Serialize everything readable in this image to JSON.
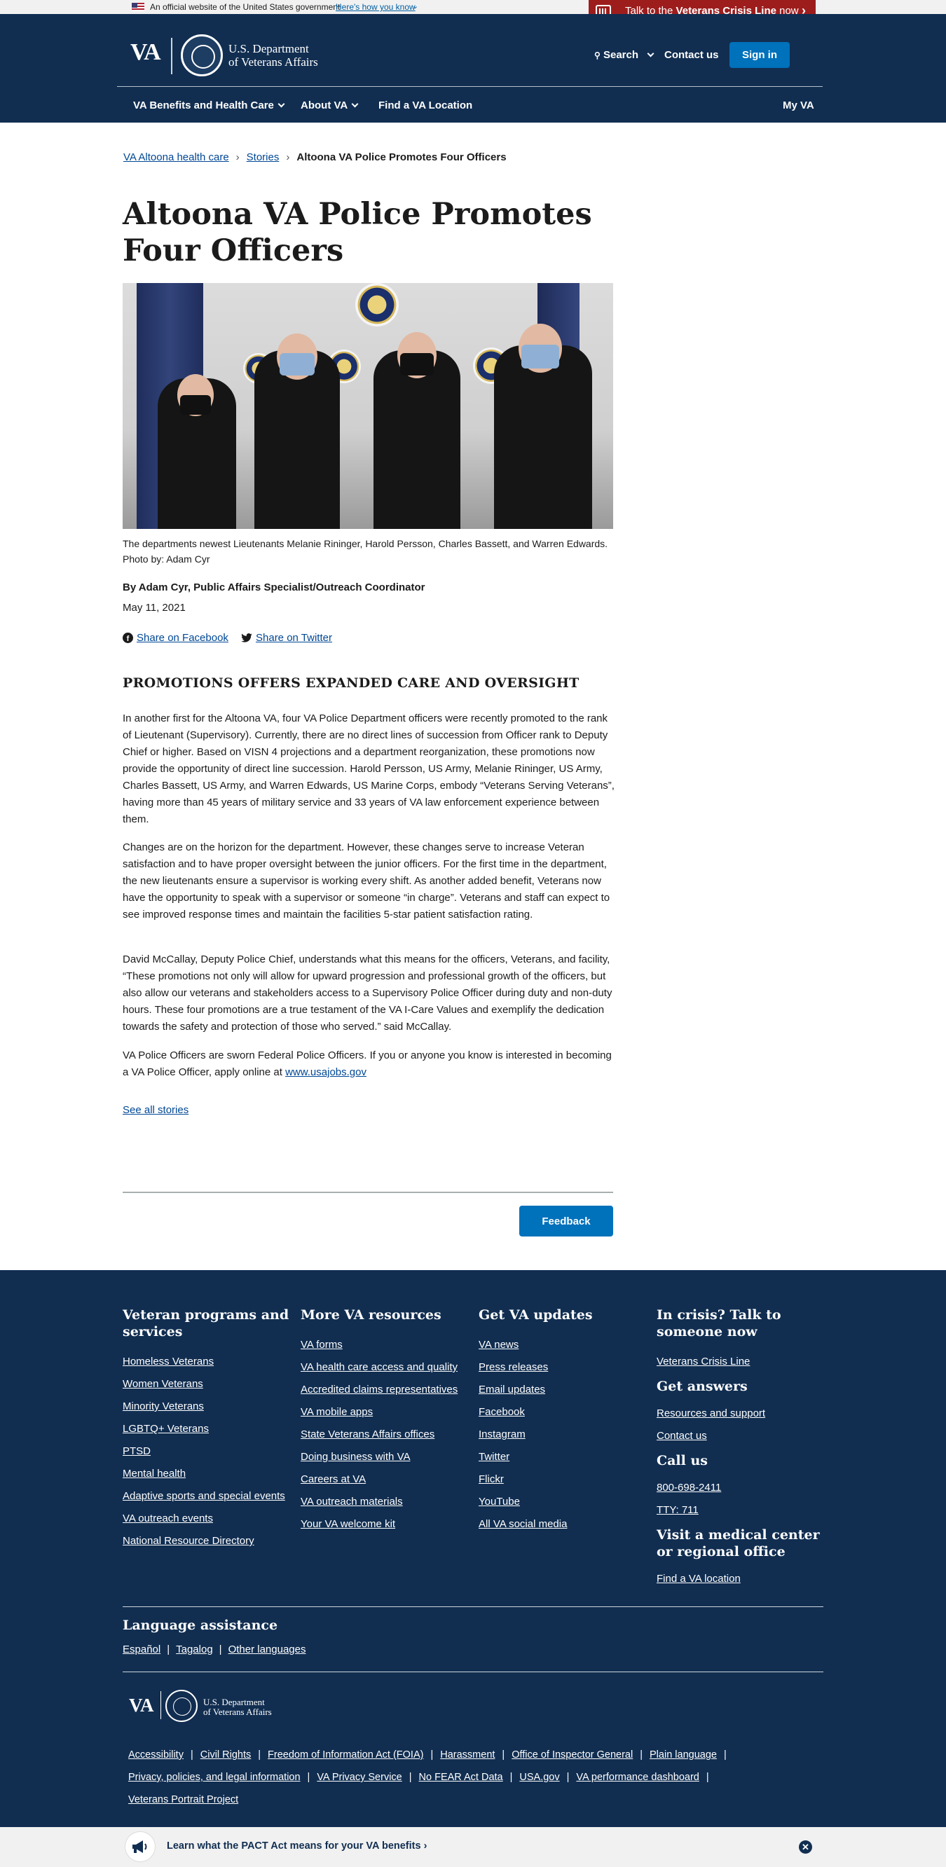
{
  "gov_banner": {
    "official_text": "An official website of the United States government",
    "how_link": "Here's how you know"
  },
  "crisis_line": {
    "prefix": "Talk to the ",
    "bold": "Veterans Crisis Line",
    "suffix": " now"
  },
  "header": {
    "logo_text": "VA",
    "dept_line1": "U.S. Department",
    "dept_line2": "of Veterans Affairs",
    "search_label": "Search",
    "contact_label": "Contact us",
    "signin_label": "Sign in",
    "menu": {
      "benefits": "VA Benefits and Health Care",
      "about": "About VA",
      "find_location": "Find a VA Location",
      "my_va": "My VA"
    }
  },
  "breadcrumb": {
    "items": [
      "VA Altoona health care",
      "Stories"
    ],
    "current": "Altoona VA Police Promotes Four Officers"
  },
  "article": {
    "title": "Altoona VA Police Promotes Four Officers",
    "caption": "The departments newest Lieutenants Melanie Rininger, Harold Persson, Charles Bassett, and Warren Edwards. Photo by: Adam Cyr",
    "byline": "By Adam Cyr, Public Affairs Specialist/Outreach Coordinator",
    "date": "May 11, 2021",
    "share_facebook": "Share on Facebook",
    "share_twitter": "Share on Twitter",
    "subhead": "PROMOTIONS OFFERS EXPANDED CARE AND OVERSIGHT",
    "paragraphs": [
      " In another first for the Altoona VA, four VA Police Department officers were recently promoted to the rank of Lieutenant (Supervisory). Currently, there are no direct lines of succession from Officer rank to Deputy Chief or higher. Based on VISN 4 projections and a department reorganization, these promotions now provide the opportunity of direct line succession. Harold Persson, US Army, Melanie Rininger, US Army, Charles Bassett, US Army, and Warren Edwards, US Marine Corps, embody “Veterans Serving Veterans”, having more than 45 years of military service and 33 years of VA law enforcement experience between them.",
      "Changes are on the horizon for the department. However, these changes serve to increase Veteran satisfaction and to have proper oversight between the junior officers. For the first time in the department, the new lieutenants ensure a supervisor is working every shift. As another added benefit, Veterans now have the opportunity to speak with a supervisor or someone “in charge”. Veterans and staff can expect to see improved response times and maintain the facilities 5-star patient satisfaction rating.",
      "David McCallay, Deputy Police Chief, understands what this means for the officers, Veterans, and facility, “These promotions not only will allow for upward  progression and professional growth of the officers,  but also allow our veterans and stakeholders access to a Supervisory Police Officer during duty and non-duty hours. These four promotions are a true testament of the VA I-Care Values and exemplify the dedication towards the safety and protection of those who served.” said McCallay."
    ],
    "last_paragraph_text": "VA Police Officers are sworn Federal Police Officers. If you or anyone you know is interested in becoming a VA Police Officer, apply online at ",
    "last_paragraph_link": "www.usajobs.gov",
    "see_all": "See all stories",
    "feedback": "Feedback"
  },
  "footer": {
    "col1": {
      "title": "Veteran programs and services",
      "links": [
        "Homeless Veterans",
        "Women Veterans",
        "Minority Veterans",
        "LGBTQ+ Veterans",
        "PTSD",
        "Mental health",
        "Adaptive sports and special events",
        "VA outreach events",
        "National Resource Directory"
      ]
    },
    "col2": {
      "title": "More VA resources",
      "links": [
        "VA forms",
        "VA health care access and quality",
        "Accredited claims representatives",
        "VA mobile apps",
        "State Veterans Affairs offices",
        "Doing business with VA",
        "Careers at VA",
        "VA outreach materials",
        "Your VA welcome kit"
      ]
    },
    "col3": {
      "title": "Get VA updates",
      "links": [
        "VA news",
        "Press releases",
        "Email updates",
        "Facebook",
        "Instagram",
        "Twitter",
        "Flickr",
        "YouTube",
        "All VA social media"
      ]
    },
    "col4": {
      "crisis_title": "In crisis? Talk to someone now",
      "crisis_link": "Veterans Crisis Line",
      "answers_title": "Get answers",
      "answers_links": [
        "Resources and support",
        "Contact us"
      ],
      "call_title": "Call us",
      "call_links": [
        "800-698-2411",
        "TTY: 711"
      ],
      "visit_title": "Visit a medical center or regional office",
      "visit_link": "Find a VA location"
    },
    "language": {
      "title": "Language assistance",
      "links": [
        "Español",
        "Tagalog",
        "Other languages"
      ]
    },
    "logo_text": "VA",
    "dept_line1": "U.S. Department",
    "dept_line2": "of Veterans Affairs",
    "legal_row1": [
      "Accessibility",
      "Civil Rights",
      "Freedom of Information Act (FOIA)",
      "Harassment",
      "Office of Inspector General",
      "Plain language"
    ],
    "legal_row2": [
      "Privacy, policies, and legal information",
      "VA Privacy Service",
      "No FEAR Act Data",
      "USA.gov",
      "VA performance dashboard"
    ],
    "legal_row3": [
      "Veterans Portrait Project"
    ]
  },
  "pact_banner": {
    "text": "Learn what the PACT Act means for your VA benefits",
    "arrow": "›"
  },
  "colors": {
    "header_bg": "#112e51",
    "crisis_red": "#9d1d1d",
    "button_blue": "#0071bb",
    "link_blue": "#004795"
  }
}
